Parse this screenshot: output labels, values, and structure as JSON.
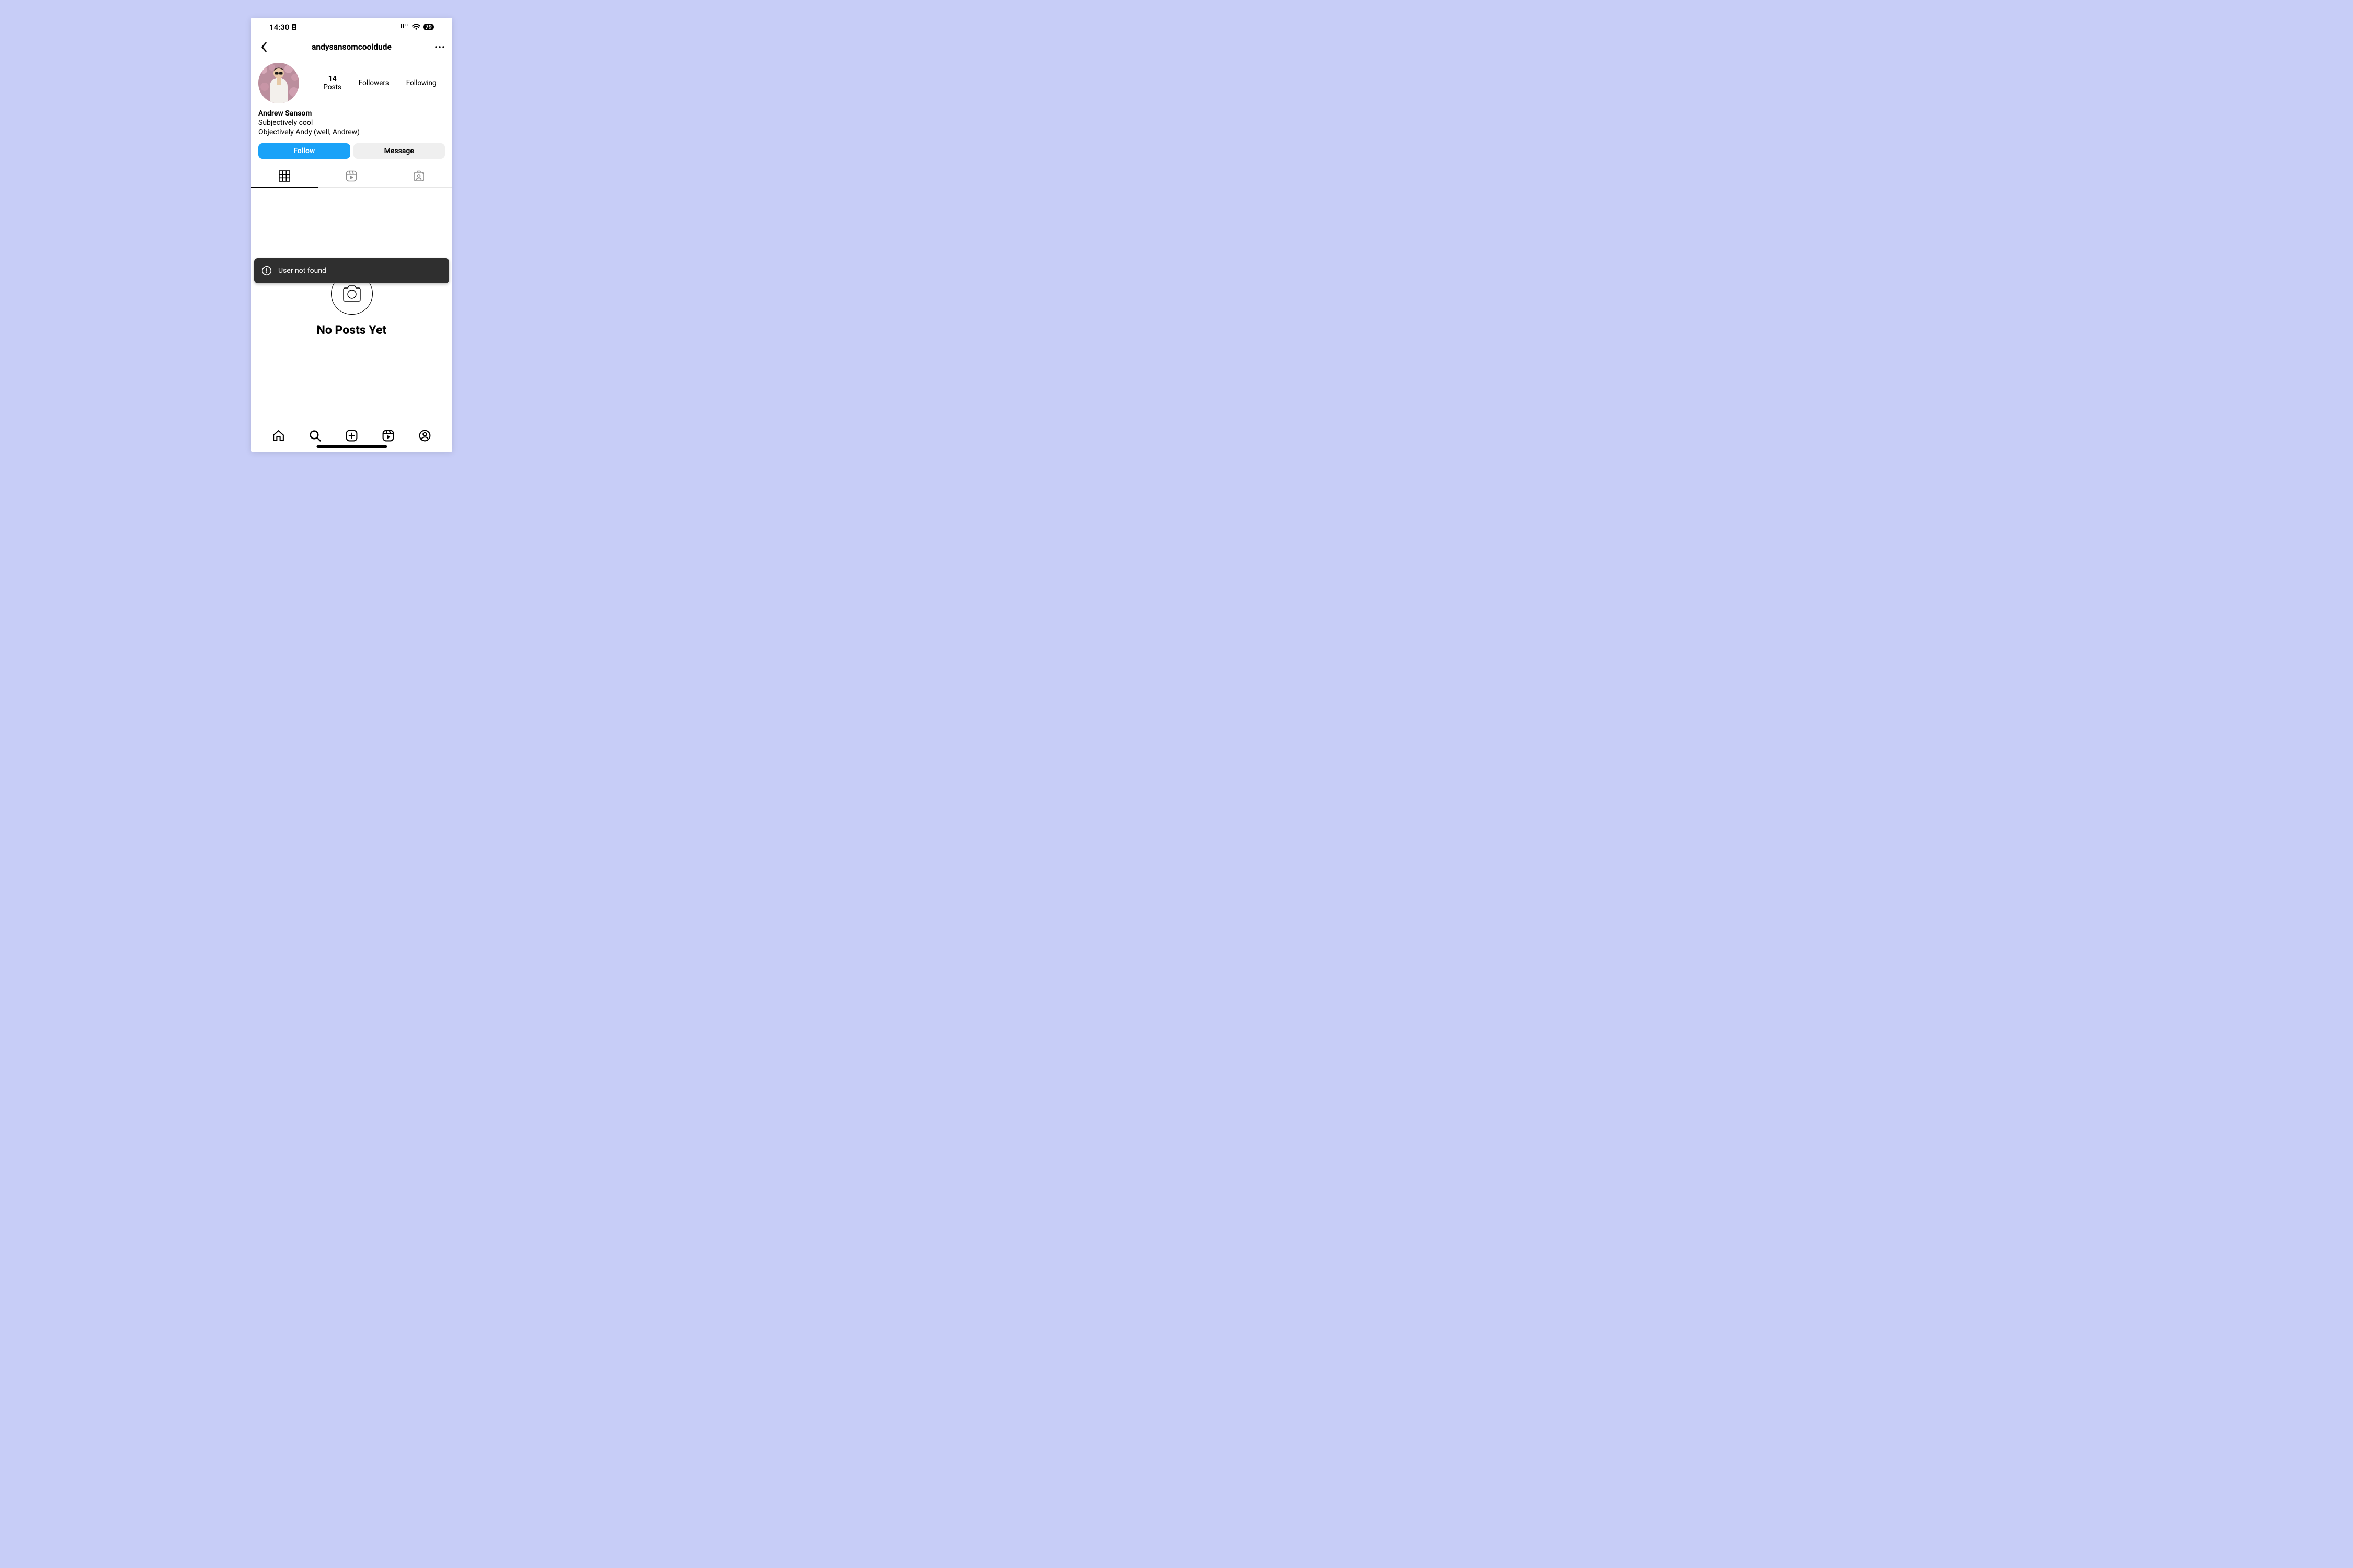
{
  "status": {
    "time": "14:30",
    "battery": "79"
  },
  "header": {
    "username": "andysansomcooldude"
  },
  "profile": {
    "stats": {
      "posts_count": "14",
      "posts_label": "Posts",
      "followers_label": "Followers",
      "following_label": "Following"
    },
    "display_name": "Andrew Sansom",
    "bio_line1": "Subjectively cool",
    "bio_line2": "Objectively Andy (well, Andrew)"
  },
  "actions": {
    "follow": "Follow",
    "message": "Message"
  },
  "toast": {
    "text": "User not found"
  },
  "feed": {
    "empty_title": "No Posts Yet"
  }
}
